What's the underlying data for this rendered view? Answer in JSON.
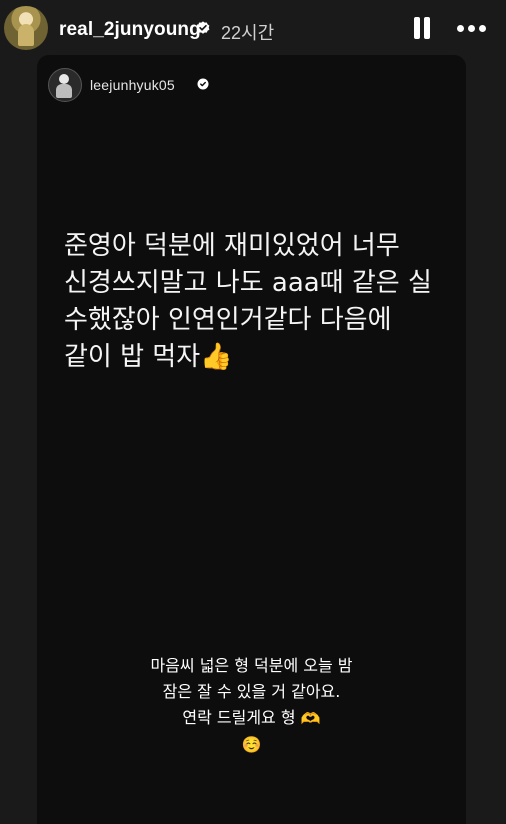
{
  "header": {
    "username": "real_2junyoung",
    "time_ago": "22시간",
    "icons": [
      "verified-badge-icon",
      "pause-icon",
      "more-options-icon"
    ]
  },
  "story_card": {
    "username": "leejunhyuk05",
    "main_text": "준영아 덕분에 재미있었어 너무\n신경쓰지말고 나도 aaa때 같은 실\n수했잖아 인연인거같다 다음에\n같이 밥 먹자",
    "main_emoji": "👍",
    "icons": [
      "verified-badge-icon"
    ]
  },
  "caption": {
    "text": "마음씨 넓은 형 덕분에 오늘 밤\n잠은 잘 수 있을 거 같아요.\n연락 드릴게요 형",
    "heart_hands_emoji": "🫶",
    "smile_emoji": "☺️"
  },
  "colors": {
    "page_background": "#1a1a1a",
    "card_background": "#0d0d0d",
    "text": "#ffffff",
    "muted_text": "#d0d0d0"
  }
}
